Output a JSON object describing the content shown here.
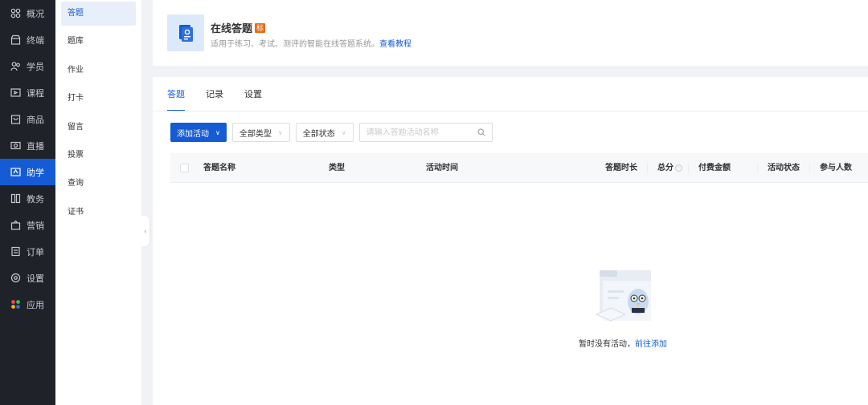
{
  "primary_nav": [
    {
      "label": "概况",
      "icon": "dashboard-icon",
      "active": false
    },
    {
      "label": "终端",
      "icon": "store-icon",
      "active": false
    },
    {
      "label": "学员",
      "icon": "users-icon",
      "active": false
    },
    {
      "label": "课程",
      "icon": "course-icon",
      "active": false
    },
    {
      "label": "商品",
      "icon": "goods-icon",
      "active": false
    },
    {
      "label": "直播",
      "icon": "live-icon",
      "active": false
    },
    {
      "label": "助学",
      "icon": "assist-icon",
      "active": true
    },
    {
      "label": "教务",
      "icon": "books-icon",
      "active": false
    },
    {
      "label": "营销",
      "icon": "marketing-icon",
      "active": false
    },
    {
      "label": "订单",
      "icon": "order-icon",
      "active": false
    },
    {
      "label": "设置",
      "icon": "settings-icon",
      "active": false
    },
    {
      "label": "应用",
      "icon": "apps-icon",
      "active": false
    }
  ],
  "secondary_nav": [
    {
      "label": "答题",
      "active": true
    },
    {
      "label": "题库",
      "active": false
    },
    {
      "label": "作业",
      "active": false
    },
    {
      "label": "打卡",
      "active": false
    },
    {
      "label": "留言",
      "active": false
    },
    {
      "label": "投票",
      "active": false
    },
    {
      "label": "查询",
      "active": false
    },
    {
      "label": "证书",
      "active": false
    }
  ],
  "header": {
    "title": "在线答题",
    "badge": "标",
    "description": "适用于练习、考试、测评的智能在线答题系统。",
    "tutorial_link": "查看教程"
  },
  "tabs": [
    {
      "label": "答题",
      "active": true
    },
    {
      "label": "记录",
      "active": false
    },
    {
      "label": "设置",
      "active": false
    }
  ],
  "toolbar": {
    "add_button": "添加活动",
    "type_filter": "全部类型",
    "status_filter": "全部状态",
    "search_placeholder": "请输入答题活动名称"
  },
  "table": {
    "columns": [
      "答题名称",
      "类型",
      "活动时间",
      "答题时长",
      "总分",
      "付费金额",
      "活动状态",
      "参与人数"
    ]
  },
  "empty_state": {
    "text": "暂时没有活动，",
    "link": "前往添加"
  },
  "colors": {
    "accent": "#155bd4",
    "nav_bg": "#1f2229",
    "badge": "#ed6a0c"
  }
}
